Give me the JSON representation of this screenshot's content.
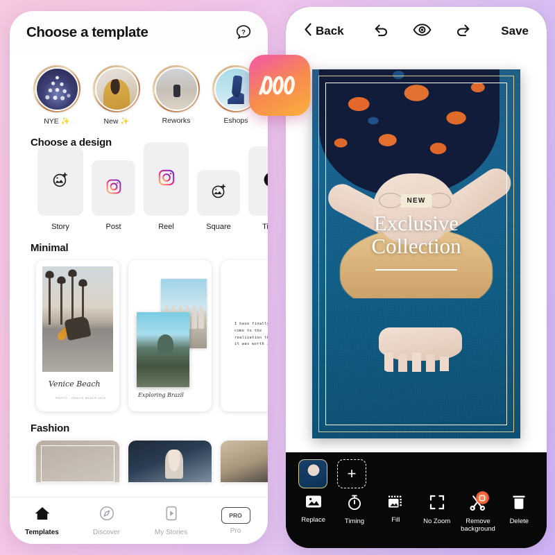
{
  "left_phone": {
    "header": {
      "title": "Choose a template",
      "help_icon": "help-bubble-icon"
    },
    "stories_section": {
      "items": [
        {
          "label": "NYE ✨",
          "art": "bokeh-christmas-tree"
        },
        {
          "label": "New ✨",
          "art": "woman-portrait"
        },
        {
          "label": "Reworks",
          "art": "desert-person"
        },
        {
          "label": "Eshops",
          "art": "blue-high-heel"
        }
      ]
    },
    "designs_section": {
      "title": "Choose a design",
      "items": [
        {
          "label": "Story",
          "icon": "photo-sparkle-icon"
        },
        {
          "label": "Post",
          "icon": "instagram-icon"
        },
        {
          "label": "Reel",
          "icon": "instagram-icon"
        },
        {
          "label": "Square",
          "icon": "photo-sparkle-icon"
        },
        {
          "label": "TikTo",
          "icon": "tiktok-icon"
        }
      ]
    },
    "minimal_section": {
      "title": "Minimal",
      "cards": [
        {
          "caption": "Venice Beach",
          "subcaption": "PHOTO · VENICE BEACH 2019"
        },
        {
          "caption": "Exploring Brazil",
          "subcaption": ""
        },
        {
          "quote": "I have finally\ncome to the\nrealization that\nit was worth it"
        }
      ]
    },
    "fashion_section": {
      "title": "Fashion"
    },
    "tabbar": {
      "items": [
        {
          "label": "Templates",
          "icon": "home-icon",
          "active": true
        },
        {
          "label": "Discover",
          "icon": "compass-icon",
          "active": false
        },
        {
          "label": "My Stories",
          "icon": "play-square-icon",
          "active": false
        },
        {
          "label": "Pro",
          "icon": "pro-badge-icon",
          "badge": "PRO",
          "active": false
        }
      ]
    }
  },
  "app_logo": {
    "name": "mojo-logo",
    "glyph": "000"
  },
  "right_phone": {
    "topbar": {
      "back_label": "Back",
      "back_icon": "chevron-left-icon",
      "undo_icon": "undo-icon",
      "preview_icon": "eye-icon",
      "redo_icon": "redo-icon",
      "save_label": "Save"
    },
    "poster": {
      "badge": "NEW",
      "title_line1": "Exclusive",
      "title_line2": "Collection",
      "frame_gold_color": "#d9c98a",
      "frame_white_color": "#ffffff",
      "background_color": "#15618c"
    },
    "clips": {
      "thumbnail_name": "clip-thumbnail-1",
      "add_label": "+"
    },
    "tools": [
      {
        "label": "Replace",
        "icon": "image-icon"
      },
      {
        "label": "Timing",
        "icon": "stopwatch-icon"
      },
      {
        "label": "Fill",
        "icon": "fill-frame-icon"
      },
      {
        "label": "No Zoom",
        "icon": "expand-corners-icon"
      },
      {
        "label": "Remove\nbackground",
        "label_line1": "Remove",
        "label_line2": "background",
        "icon": "scissors-icon",
        "badge_icon": "magic-dot-icon",
        "badge_color": "#f4653c"
      },
      {
        "label": "Delete",
        "icon": "trash-icon"
      }
    ]
  },
  "theme": {
    "background_gradient_start": "#f7c8e0",
    "background_gradient_end": "#cdb4f5",
    "accent_pink": "#f45d9e",
    "accent_orange": "#fbb03b"
  }
}
